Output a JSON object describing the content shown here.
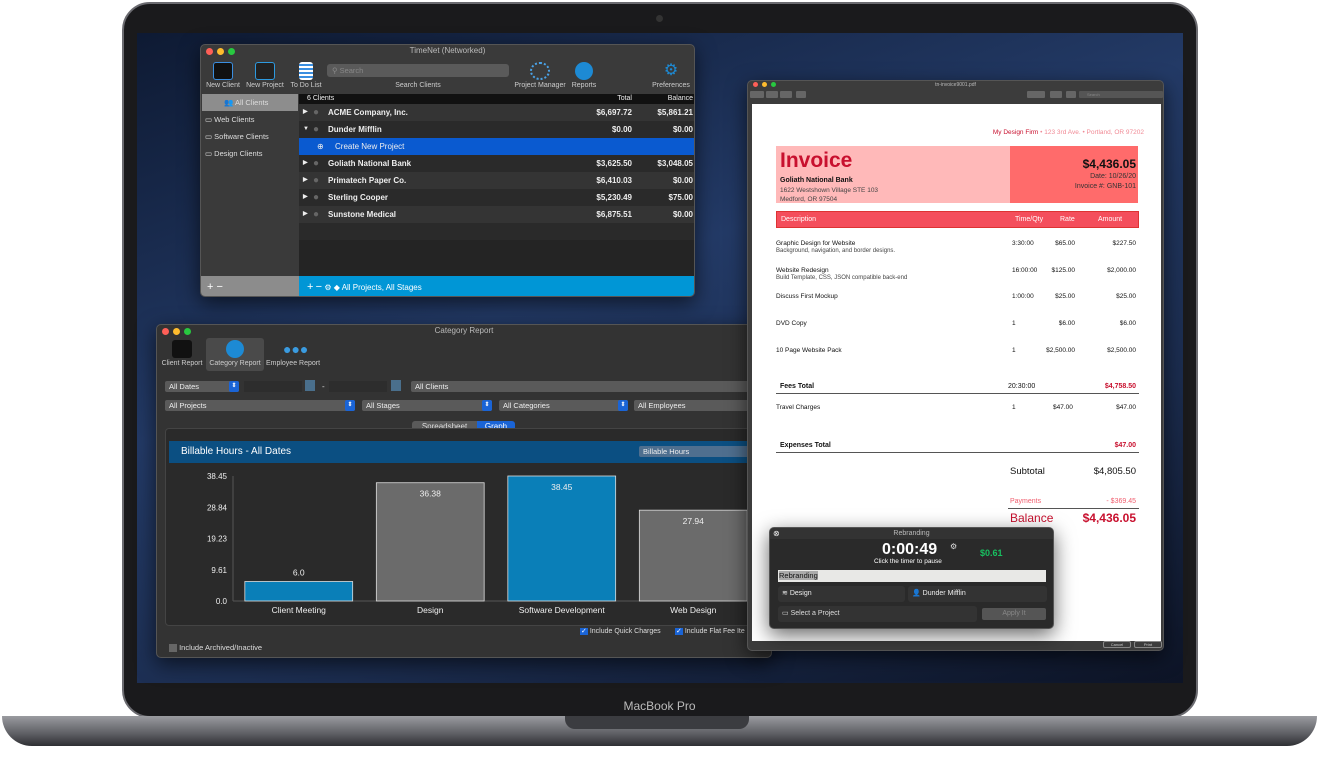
{
  "device": {
    "brand": "MacBook Pro"
  },
  "main": {
    "title": "TimeNet (Networked)",
    "toolbar": [
      {
        "label": "New Client",
        "icon": "client-card-icon"
      },
      {
        "label": "New Project",
        "icon": "project-folder-icon"
      },
      {
        "label": "To Do List",
        "icon": "todo-list-icon"
      },
      {
        "label": "Project Manager",
        "icon": "flower-icon"
      },
      {
        "label": "Reports",
        "icon": "reports-icon"
      },
      {
        "label": "Preferences",
        "icon": "gear-icon"
      }
    ],
    "search": {
      "placeholder": "Search",
      "label": "Search Clients"
    },
    "sidebar": [
      {
        "label": "All Clients",
        "selected": true
      },
      {
        "label": "Web Clients"
      },
      {
        "label": "Software Clients"
      },
      {
        "label": "Design Clients"
      }
    ],
    "columns": {
      "count": "6 Clients",
      "total": "Total",
      "balance": "Balance"
    },
    "clients": [
      {
        "name": "ACME Company, Inc.",
        "total": "$6,697.72",
        "balance": "$5,861.21"
      },
      {
        "name": "Dunder Mifflin",
        "total": "$0.00",
        "balance": "$0.00"
      },
      {
        "name": "Goliath National Bank",
        "total": "$3,625.50",
        "balance": "$3,048.05"
      },
      {
        "name": "Primatech Paper Co.",
        "total": "$6,410.03",
        "balance": "$0.00"
      },
      {
        "name": "Sterling Cooper",
        "total": "$5,230.49",
        "balance": "$75.00"
      },
      {
        "name": "Sunstone Medical",
        "total": "$6,875.51",
        "balance": "$0.00"
      }
    ],
    "create_project": "Create New Project",
    "filter": "All Projects, All Stages",
    "accent": "#0096d6"
  },
  "report": {
    "title": "Category Report",
    "tabs": [
      {
        "label": "Client Report"
      },
      {
        "label": "Category Report",
        "selected": true
      },
      {
        "label": "Employee Report"
      }
    ],
    "filters": {
      "dates": "All Dates",
      "clients": "All Clients",
      "projects": "All Projects",
      "stages": "All Stages",
      "categories": "All Categories",
      "employees": "All Employees",
      "date_sep": "-"
    },
    "view": {
      "spreadsheet": "Spreadsheet",
      "graph": "Graph"
    },
    "graph_title": "Billable Hours - All Dates",
    "metric": "Billable Hours",
    "include_quick": "Include Quick Charges",
    "include_flat": "Include Flat Fee Ite",
    "include_archived": "Include Archived/Inactive"
  },
  "chart_data": {
    "type": "bar",
    "title": "Billable Hours - All Dates",
    "categories": [
      "Client Meeting",
      "Design",
      "Software Development",
      "Web Design"
    ],
    "values": [
      6.0,
      36.38,
      38.45,
      27.94
    ],
    "value_labels": [
      "6.0",
      "36.38",
      "38.45",
      "27.94"
    ],
    "yticks": [
      "0.0",
      "9.61",
      "19.23",
      "28.84",
      "38.45"
    ],
    "ylim": [
      0,
      38.45
    ],
    "colors": [
      "#0a7fb8",
      "#6b6b6b",
      "#0a7fb8",
      "#6b6b6b"
    ],
    "grid": false
  },
  "invoice": {
    "filename": "tn-invoice9001.pdf",
    "search_placeholder": "Search",
    "firm": "My Design Firm",
    "firm_addr1": "123 3rd Ave.",
    "firm_addr2": "Portland, OR 97202",
    "heading": "Invoice",
    "client": "Goliath National Bank",
    "addr1": "1622 Westshown Village   STE 103",
    "addr2": "Medford, OR 97504",
    "amount": "$4,436.05",
    "date": "Date: 10/26/20",
    "number": "Invoice #: GNB-101",
    "cols": [
      "Description",
      "Time/Qty",
      "Rate",
      "Amount"
    ],
    "lines": [
      {
        "d": "Graphic Design for Website",
        "sub": "Background, navigation, and border designs.",
        "q": "3:30:00",
        "r": "$65.00",
        "a": "$227.50"
      },
      {
        "d": "Website Redesign",
        "sub": "Build Template, CSS, JSON compatible back-end",
        "q": "16:00:00",
        "r": "$125.00",
        "a": "$2,000.00"
      },
      {
        "d": "Discuss First Mockup",
        "sub": "",
        "q": "1:00:00",
        "r": "$25.00",
        "a": "$25.00"
      },
      {
        "d": "DVD Copy",
        "sub": "",
        "q": "1",
        "r": "$6.00",
        "a": "$6.00"
      },
      {
        "d": "10 Page Website Pack",
        "sub": "",
        "q": "1",
        "r": "$2,500.00",
        "a": "$2,500.00"
      }
    ],
    "fees_label": "Fees Total",
    "fees_time": "20:30:00",
    "fees_total": "$4,758.50",
    "travel": {
      "d": "Travel Charges",
      "q": "1",
      "r": "$47.00",
      "a": "$47.00"
    },
    "exp_label": "Expenses Total",
    "exp_total": "$47.00",
    "subtotal_label": "Subtotal",
    "subtotal": "$4,805.50",
    "payments_label": "Payments",
    "payments": "- $369.45",
    "balance_label": "Balance",
    "balance": "$4,436.05",
    "cancel": "Cancel",
    "print": "Print"
  },
  "timer": {
    "title": "Rebranding",
    "time": "0:00:49",
    "hint": "Click the timer to pause",
    "amount": "$0.61",
    "name": "Rebranding",
    "category": "Design",
    "client": "Dunder Mifflin",
    "project_placeholder": "Select a Project",
    "apply": "Apply It"
  }
}
